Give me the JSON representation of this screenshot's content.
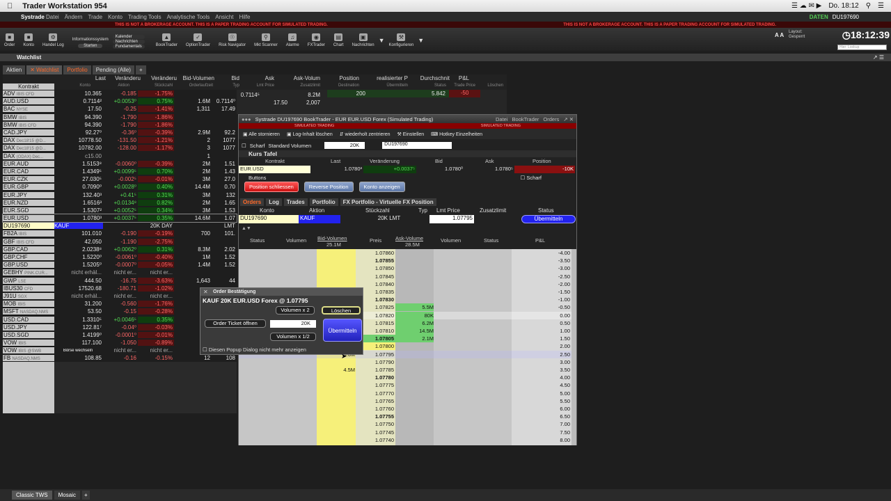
{
  "mac": {
    "app": "Trader Workstation 954",
    "clock": "Do. 18:12"
  },
  "appmenu": {
    "brand": "Systrade",
    "items": [
      "Datei",
      "Ändern",
      "Trade",
      "Konto",
      "Trading Tools",
      "Analytische Tools",
      "Ansicht",
      "Hilfe"
    ],
    "daten": "DATEN",
    "account": "DU197690"
  },
  "warning": "THIS IS NOT A BROKERAGE ACCOUNT. THIS IS A PAPER TRADING ACCOUNT FOR SIMULATED TRADING.",
  "toolbar": {
    "items": [
      "Order",
      "Konto",
      "Handel Log",
      "Informationssystem",
      "Starten",
      "Kalender",
      "Nachrichten",
      "Fundamentals",
      "BookTrader",
      "OptionTrader",
      "Risk Navigator",
      "Mkt Scanner",
      "Alarme",
      "FXTrader",
      "Chart",
      "Nachrichten",
      "Konfigurieren"
    ],
    "time": "18:12:39",
    "layout": "Layout:",
    "layout_val": "Gesperrt",
    "quick": "Hier: Lookup"
  },
  "watchlist": {
    "title": "Watchlist",
    "tabs": [
      "Aktien",
      "Watchlist",
      "Portfolio",
      "Pending (Alle)",
      "+"
    ],
    "headers": [
      "Last",
      "Veränderu",
      "Veränderu",
      "Bid-Volumen",
      "Bid",
      "Ask",
      "Ask-Volum",
      "Position",
      "realisierter P",
      "Durchschnit",
      "P&L"
    ],
    "subheaders": [
      "Konto",
      "Aktion",
      "Stückzahl",
      "Orderlaufzeit",
      "Typ",
      "Lmt Price",
      "Zusatzlimit",
      "Destination",
      "Übermitteln",
      "Status",
      "Trade Price",
      "Löschen"
    ],
    "kontrakt": "Kontrakt",
    "rows": [
      {
        "k": "ADV",
        "x": "IBIS CFD",
        "last": "10.365",
        "ch": "-0.185",
        "pct": "-1.75%",
        "bv": "",
        "bid": "",
        "t": "n"
      },
      {
        "k": "AUD.USD",
        "x": "",
        "last": "0.7114²",
        "ch": "+0.0053⁰",
        "pct": "0.75%",
        "bv": "1.6M",
        "bid": "0.7114⁰",
        "t": "p"
      },
      {
        "k": "BAC",
        "x": "NYSE",
        "last": "17.50",
        "ch": "-0.25",
        "pct": "-1.41%",
        "bv": "1,311",
        "bid": "17.49",
        "t": "n"
      },
      {
        "k": "BMW",
        "x": "IBIS",
        "last": "94.390",
        "ch": "-1.790",
        "pct": "-1.86%",
        "bv": "",
        "bid": "",
        "t": "n"
      },
      {
        "k": "BMW",
        "x": "IBIS CFD",
        "last": "94.390",
        "ch": "-1.790",
        "pct": "-1.86%",
        "bv": "",
        "bid": "",
        "t": "n"
      },
      {
        "k": "CAD.JPY",
        "x": "",
        "last": "92.27⁰",
        "ch": "-0.36⁰",
        "pct": "-0.39%",
        "bv": "2.9M",
        "bid": "92.2",
        "t": "n"
      },
      {
        "k": "DAX",
        "x": "Dec18'15 @D...",
        "last": "10778.50",
        "ch": "-131.50",
        "pct": "-1.21%",
        "bv": "2",
        "bid": "1077",
        "t": "n"
      },
      {
        "k": "DAX",
        "x": "Dec18'15 @D...",
        "last": "10782.00",
        "ch": "-128.00",
        "pct": "-1.17%",
        "bv": "3",
        "bid": "1077",
        "t": "n"
      },
      {
        "k": "DAX",
        "x": "(ODAX) Dec...",
        "last": "c15.00",
        "ch": "",
        "pct": "",
        "bv": "1",
        "bid": "",
        "t": "x"
      },
      {
        "k": "EUR.AUD",
        "x": "",
        "last": "1.5153⁸",
        "ch": "-0.0060⁰",
        "pct": "-0.39%",
        "bv": "2M",
        "bid": "1.51",
        "t": "n"
      },
      {
        "k": "EUR.CAD",
        "x": "",
        "last": "1.4349⁵",
        "ch": "+0.0099⁵",
        "pct": "0.70%",
        "bv": "2M",
        "bid": "1.43",
        "t": "p"
      },
      {
        "k": "EUR.CZK",
        "x": "",
        "last": "27.030⁵",
        "ch": "-0.002⁵",
        "pct": "-0.01%",
        "bv": "3M",
        "bid": "27.0",
        "t": "n"
      },
      {
        "k": "EUR.GBP",
        "x": "",
        "last": "0.7090⁰",
        "ch": "+0.0028⁰",
        "pct": "0.40%",
        "bv": "14.4M",
        "bid": "0.70",
        "t": "p"
      },
      {
        "k": "EUR.JPY",
        "x": "",
        "last": "132.40³",
        "ch": "+0.41⁵",
        "pct": "0.31%",
        "bv": "3M",
        "bid": "132",
        "t": "p"
      },
      {
        "k": "EUR.NZD",
        "x": "",
        "last": "1.6516³",
        "ch": "+0.0134⁸",
        "pct": "0.82%",
        "bv": "2M",
        "bid": "1.65",
        "t": "p"
      },
      {
        "k": "EUR.SGD",
        "x": "",
        "last": "1.5307²",
        "ch": "+0.0052⁵",
        "pct": "0.34%",
        "bv": "3M",
        "bid": "1.53",
        "t": "p"
      },
      {
        "k": "EUR.USD",
        "x": "",
        "last": "1.0780³",
        "ch": "+0.0037⁵",
        "pct": "0.35%",
        "bv": "14.6M",
        "bid": "1.07",
        "t": "p"
      },
      {
        "k": "DU197690",
        "x": "",
        "last": "KAUF",
        "ch": "",
        "pct": "20K DAY",
        "bv": "",
        "bid": "LMT",
        "t": "o"
      },
      {
        "k": "FB2A",
        "x": "IBIS",
        "last": "101.010",
        "ch": "-0.190",
        "pct": "-0.19%",
        "bv": "700",
        "bid": "101.",
        "t": "n"
      },
      {
        "k": "GBF",
        "x": "IBIS CFD",
        "last": "42.050",
        "ch": "-1.190",
        "pct": "-2.75%",
        "bv": "",
        "bid": "",
        "t": "n"
      },
      {
        "k": "GBP.CAD",
        "x": "",
        "last": "2.0238⁸",
        "ch": "+0.0062⁰",
        "pct": "0.31%",
        "bv": "8.3M",
        "bid": "2.02",
        "t": "p"
      },
      {
        "k": "GBP.CHF",
        "x": "",
        "last": "1.5220⁰",
        "ch": "-0.0061⁰",
        "pct": "-0.40%",
        "bv": "1M",
        "bid": "1.52",
        "t": "n"
      },
      {
        "k": "GBP.USD",
        "x": "",
        "last": "1.5205⁰",
        "ch": "-0.0007⁰",
        "pct": "-0.05%",
        "bv": "1.4M",
        "bid": "1.52",
        "t": "n"
      },
      {
        "k": "GEBHY",
        "x": "PINK.CUR...",
        "last": "nicht erhäl...",
        "ch": "nicht er...",
        "pct": "nicht er...",
        "bv": "",
        "bid": "",
        "t": "x"
      },
      {
        "k": "GWP",
        "x": "LSE",
        "last": "444.50",
        "ch": "-16.75",
        "pct": "-3.63%",
        "bv": "1,643",
        "bid": "44",
        "t": "n"
      },
      {
        "k": "IBUS30",
        "x": "CFD",
        "last": "17520.68",
        "ch": "-180.71",
        "pct": "-1.02%",
        "bv": "",
        "bid": "",
        "t": "n"
      },
      {
        "k": "J91U",
        "x": "SGX",
        "last": "nicht erhäl...",
        "ch": "nicht er...",
        "pct": "nicht er...",
        "bv": "",
        "bid": "",
        "t": "x"
      },
      {
        "k": "MOB",
        "x": "IBIS",
        "last": "31.200",
        "ch": "-0.560",
        "pct": "-1.76%",
        "bv": "",
        "bid": "",
        "t": "n"
      },
      {
        "k": "MSFT",
        "x": "NASDAQ.NMS",
        "last": "53.50",
        "ch": "-0.15",
        "pct": "-0.28%",
        "bv": "",
        "bid": "",
        "t": "n"
      },
      {
        "k": "USD.CAD",
        "x": "",
        "last": "1.3310⁵",
        "ch": "+0.0046⁵",
        "pct": "0.35%",
        "bv": "",
        "bid": "",
        "t": "p"
      },
      {
        "k": "USD.JPY",
        "x": "",
        "last": "122.81⁷",
        "ch": "-0.04⁰",
        "pct": "-0.03%",
        "bv": "",
        "bid": "",
        "t": "n"
      },
      {
        "k": "USD.SGD",
        "x": "",
        "last": "1.4199⁰",
        "ch": "-0.0001⁰",
        "pct": "-0.01%",
        "bv": "",
        "bid": "",
        "t": "n"
      },
      {
        "k": "VOW",
        "x": "IBIS",
        "last": "117.100",
        "ch": "-1.050",
        "pct": "-0.89%",
        "bv": "",
        "bid": "",
        "t": "n"
      },
      {
        "k": "VOW",
        "x": "IBIS @SWB",
        "last": "Börse wechseln",
        "ch": "nicht er...",
        "pct": "nicht er...",
        "bv": "",
        "bid": "",
        "t": "x"
      },
      {
        "k": "FB",
        "x": "NASDAQ.NMS",
        "last": "108.85",
        "ch": "-0.16",
        "pct": "-0.15%",
        "bv": "12",
        "bid": "108",
        "t": "n2"
      }
    ],
    "audusd_ask": "0.7114⁵",
    "audusd_askvol": "8.2M",
    "bac_ask": "17.50",
    "bac_askvol": "2,007",
    "pos": "200",
    "durch": "5.842",
    "pnl": "-50"
  },
  "booktrader": {
    "title": "Systrade    DU197690 BookTrader - EUR EUR.USD Forex (Simulated Trading)",
    "menu": [
      "Datei",
      "BookTrader",
      "Orders"
    ],
    "sim1": "SIMULATED TRADING",
    "sim2": "SIMULATED TRADING",
    "tools": [
      "Alle stornieren",
      "Log-Inhalt löschen",
      "wiederholt zentrieren",
      "Einstellen",
      "Hotkey Einzelheiten"
    ],
    "scharf": "Scharf",
    "stdvol": "Standard Volumen",
    "size": "20K",
    "acct": "DU197690",
    "kurstafel": "Kurs Tafel",
    "kt_head": [
      "Kontrakt",
      "Last",
      "Veränderung",
      "Bid",
      "Ask",
      "Position"
    ],
    "kt_row": [
      "EUR.USD",
      "1.0780³",
      "+0.0037⁵",
      "1.0780⁰",
      "1.0780⁵",
      "-10K"
    ],
    "buttons_label": "Buttons",
    "btn_close": "Position schliessen",
    "btn_reverse": "Reverse Position",
    "btn_acct": "Konto anzeigen",
    "scharf2": "Scharf",
    "tabs": [
      "Orders",
      "Log",
      "Trades",
      "Portfolio",
      "FX Portfolio - Virtuelle FX Position"
    ],
    "oh": [
      "Konto",
      "Aktion",
      "Stückzahl",
      "Typ",
      "Lmt Price",
      "Zusatzlimit",
      "Status"
    ],
    "orow": [
      "DU197690",
      "KAUF",
      "20K  LMT",
      "",
      "1.07795",
      "",
      "Übermitteln"
    ],
    "lh": [
      "Status",
      "Volumen",
      "Bid-Volumen",
      "Preis",
      "Ask-Volume",
      "Volumen",
      "Status",
      "P&L"
    ],
    "lh_sub": [
      "25.1M",
      "28.5M"
    ],
    "ladder": [
      [
        "1.07860",
        "",
        "",
        "-4.00"
      ],
      [
        "1.07855",
        "",
        "",
        "-3.50"
      ],
      [
        "1.07850",
        "",
        "",
        "-3.00"
      ],
      [
        "1.07845",
        "",
        "",
        "-2.50"
      ],
      [
        "1.07840",
        "",
        "",
        "-2.00"
      ],
      [
        "1.07835",
        "",
        "",
        "-1.50"
      ],
      [
        "1.07830",
        "",
        "",
        "-1.00"
      ],
      [
        "1.07825",
        "",
        "5.5M",
        "-0.50"
      ],
      [
        "1.07820",
        "",
        "80K",
        "0.00"
      ],
      [
        "1.07815",
        "",
        "6.2M",
        "0.50"
      ],
      [
        "1.07810",
        "",
        "14.5M",
        "1.00"
      ],
      [
        "1.07805",
        "",
        "2.1M",
        "1.50"
      ],
      [
        "1.07800",
        "",
        "",
        "2.00"
      ],
      [
        "1.07795",
        "5.6M",
        "",
        "2.50"
      ],
      [
        "1.07790",
        "",
        "",
        "3.00"
      ],
      [
        "1.07785",
        "4.5M",
        "",
        "3.50"
      ],
      [
        "1.07780",
        "",
        "",
        "4.00"
      ],
      [
        "1.07775",
        "",
        "",
        "4.50"
      ],
      [
        "1.07770",
        "",
        "",
        "5.00"
      ],
      [
        "1.07765",
        "",
        "",
        "5.50"
      ],
      [
        "1.07760",
        "",
        "",
        "6.00"
      ],
      [
        "1.07755",
        "",
        "",
        "6.50"
      ],
      [
        "1.07750",
        "",
        "",
        "7.00"
      ],
      [
        "1.07745",
        "",
        "",
        "7.50"
      ],
      [
        "1.07740",
        "",
        "",
        "8.00"
      ]
    ]
  },
  "popup": {
    "title": "Order Bestätigung",
    "info": "KAUF 20K EUR.USD Forex @ 1.07795",
    "vol2": "Volumen x 2",
    "del": "Löschen",
    "ticket": "Order Ticket öffnen",
    "size": "20K",
    "submit": "Übermitteln",
    "half": "Volumen x 1/2",
    "chk": "Diesen Popup Dialog nicht mehr anzeigen"
  },
  "bottom": [
    "Classic TWS",
    "Mosaic",
    "+"
  ]
}
